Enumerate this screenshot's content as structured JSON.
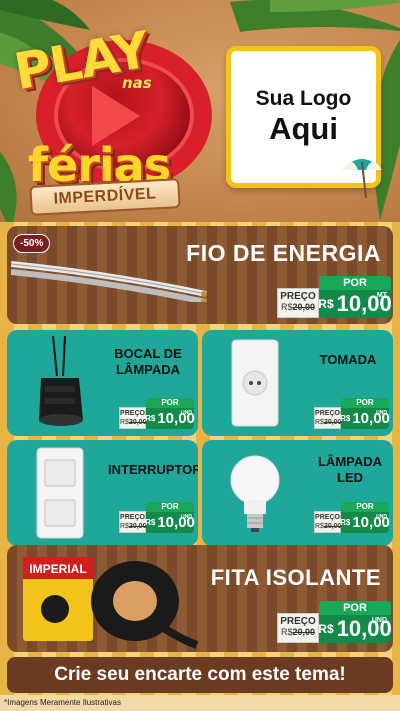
{
  "header": {
    "campaign_word1": "PLAY",
    "campaign_word2": "nas",
    "campaign_word3": "férias",
    "campaign_tag": "IMPERDÍVEL",
    "logo_line1": "Sua Logo",
    "logo_line2": "Aqui"
  },
  "products": [
    {
      "title": "FIO DE ENERGIA",
      "discount": "-50%",
      "price_label": "PREÇO",
      "old_price_prefix": "R$",
      "old_price": "20,00",
      "por_label": "POR",
      "currency": "R$",
      "price": "10,00",
      "unit": "MT"
    },
    {
      "title_line1": "BOCAL DE",
      "title_line2": "LÂMPADA",
      "price_label": "PREÇO",
      "old_price_prefix": "R$",
      "old_price": "20,00",
      "por_label": "POR",
      "currency": "R$",
      "price": "10,00",
      "unit": "UND"
    },
    {
      "title_line1": "TOMADA",
      "price_label": "PREÇO",
      "old_price_prefix": "R$",
      "old_price": "20,00",
      "por_label": "POR",
      "currency": "R$",
      "price": "10,00",
      "unit": "UND"
    },
    {
      "title_line1": "INTERRUPTOR",
      "price_label": "PREÇO",
      "old_price_prefix": "R$",
      "old_price": "20,00",
      "por_label": "POR",
      "currency": "R$",
      "price": "10,00",
      "unit": "UND"
    },
    {
      "title_line1": "LÂMPADA",
      "title_line2": "LED",
      "price_label": "PREÇO",
      "old_price_prefix": "R$",
      "old_price": "20,00",
      "por_label": "POR",
      "currency": "R$",
      "price": "10,00",
      "unit": "UND"
    },
    {
      "title": "FITA ISOLANTE",
      "price_label": "PREÇO",
      "old_price_prefix": "R$",
      "old_price": "20,00",
      "por_label": "POR",
      "currency": "R$",
      "price": "10,00",
      "unit": "UND",
      "brand": "IMPERIAL"
    }
  ],
  "cta": "Crie seu encarte com este tema!",
  "footnote": "*Imagens Meramente Ilustrativas",
  "colors": {
    "teal_card": "#1fa89a",
    "brown_card": "#7a4a2a",
    "price_green": "#138a4a",
    "accent_yellow": "#f2c318",
    "brand_red": "#d6202a"
  },
  "icons": [
    "palm-leaf-icon",
    "play-icon",
    "umbrella-icon",
    "cable-image",
    "socket-image",
    "outlet-image",
    "switch-image",
    "bulb-image",
    "tape-image"
  ]
}
